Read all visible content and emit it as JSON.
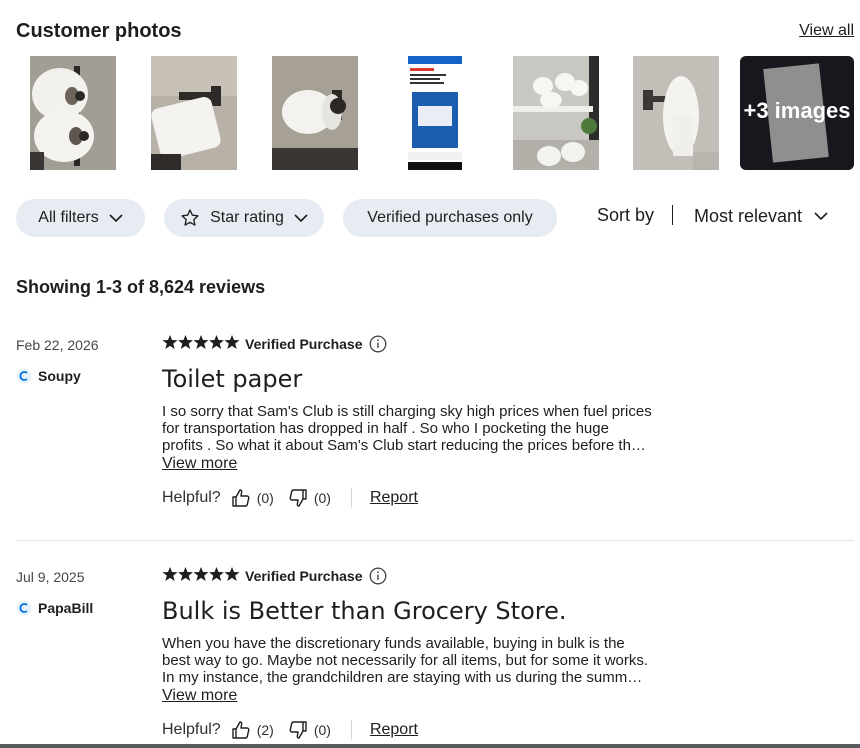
{
  "photos": {
    "title": "Customer photos",
    "view_all": "View all",
    "more_label": "+3 images",
    "thumbs": [
      {
        "icon": "double-toilet-roll-holder-photo"
      },
      {
        "icon": "paper-towel-roll-photo"
      },
      {
        "icon": "toilet-roll-on-holder-photo"
      },
      {
        "icon": "product-listing-screenshot-photo"
      },
      {
        "icon": "rolls-on-shelf-photo"
      },
      {
        "icon": "wall-mounted-roll-photo"
      }
    ]
  },
  "filters": {
    "all_filters": "All filters",
    "star_rating": "Star rating",
    "verified_only": "Verified purchases only",
    "sort_by_label": "Sort by",
    "sort_value": "Most relevant"
  },
  "showing": "Showing 1-3 of 8,624 reviews",
  "reviews": [
    {
      "date": "Feb 22, 2026",
      "reviewer": "Soupy",
      "rating": 5,
      "verified": "Verified Purchase",
      "title": "Toilet paper",
      "body_lines": [
        "I so sorry that Sam's Club is still charging sky high prices when fuel prices",
        "for transportation has dropped in half . So who I pocketing the huge",
        "profits . So what it about Sam's Club start reducing the prices before th…"
      ],
      "view_more": "View more",
      "helpful_label": "Helpful?",
      "up_count": "(0)",
      "down_count": "(0)",
      "report": "Report"
    },
    {
      "date": "Jul 9, 2025",
      "reviewer": "PapaBill",
      "rating": 5,
      "verified": "Verified Purchase",
      "title": "Bulk is Better than Grocery Store.",
      "body_lines": [
        "When you have the discretionary funds available, buying in bulk is the",
        "best way to go. Maybe not necessarily for all items, but for some it works.",
        "In my instance, the grandchildren are staying with us during the summ…"
      ],
      "view_more": "View more",
      "helpful_label": "Helpful?",
      "up_count": "(2)",
      "down_count": "(0)",
      "report": "Report"
    }
  ],
  "colors": {
    "chip_bg": "#e6ecf1",
    "text": "#1d1e20",
    "star": "#1d1e20",
    "divider": "#e3e4e5",
    "avatar_accent": "#0071dc"
  }
}
